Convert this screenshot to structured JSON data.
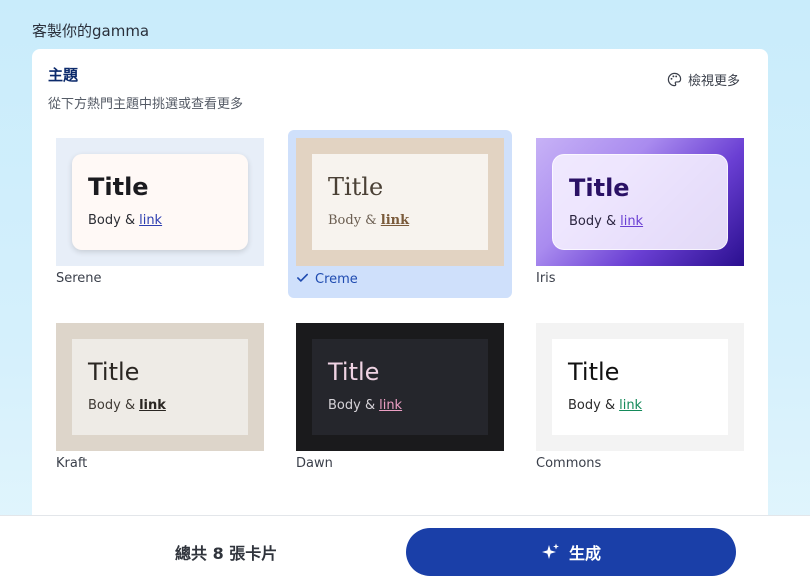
{
  "page": {
    "heading": "客製你的gamma"
  },
  "panel": {
    "title": "主題",
    "subtitle": "從下方熱門主題中挑選或查看更多",
    "view_more": "檢視更多"
  },
  "themes": [
    {
      "name": "Serene",
      "preview_title": "Title",
      "preview_body": "Body &",
      "preview_link": "link",
      "selected": false
    },
    {
      "name": "Creme",
      "preview_title": "Title",
      "preview_body": "Body &",
      "preview_link": "link",
      "selected": true
    },
    {
      "name": "Iris",
      "preview_title": "Title",
      "preview_body": "Body &",
      "preview_link": "link",
      "selected": false
    },
    {
      "name": "Kraft",
      "preview_title": "Title",
      "preview_body": "Body &",
      "preview_link": "link",
      "selected": false
    },
    {
      "name": "Dawn",
      "preview_title": "Title",
      "preview_body": "Body &",
      "preview_link": "link",
      "selected": false
    },
    {
      "name": "Commons",
      "preview_title": "Title",
      "preview_body": "Body &",
      "preview_link": "link",
      "selected": false
    }
  ],
  "footer": {
    "card_count": "總共 8 張卡片",
    "generate_label": "生成"
  },
  "icons": {
    "view_more": "palette-icon",
    "selected_marker": "checkmark-icon",
    "generate": "sparkle-icon"
  },
  "colors": {
    "accent": "#1a3fa8",
    "selected_bg": "#cfe0fb",
    "heading": "#0c2a6b"
  }
}
